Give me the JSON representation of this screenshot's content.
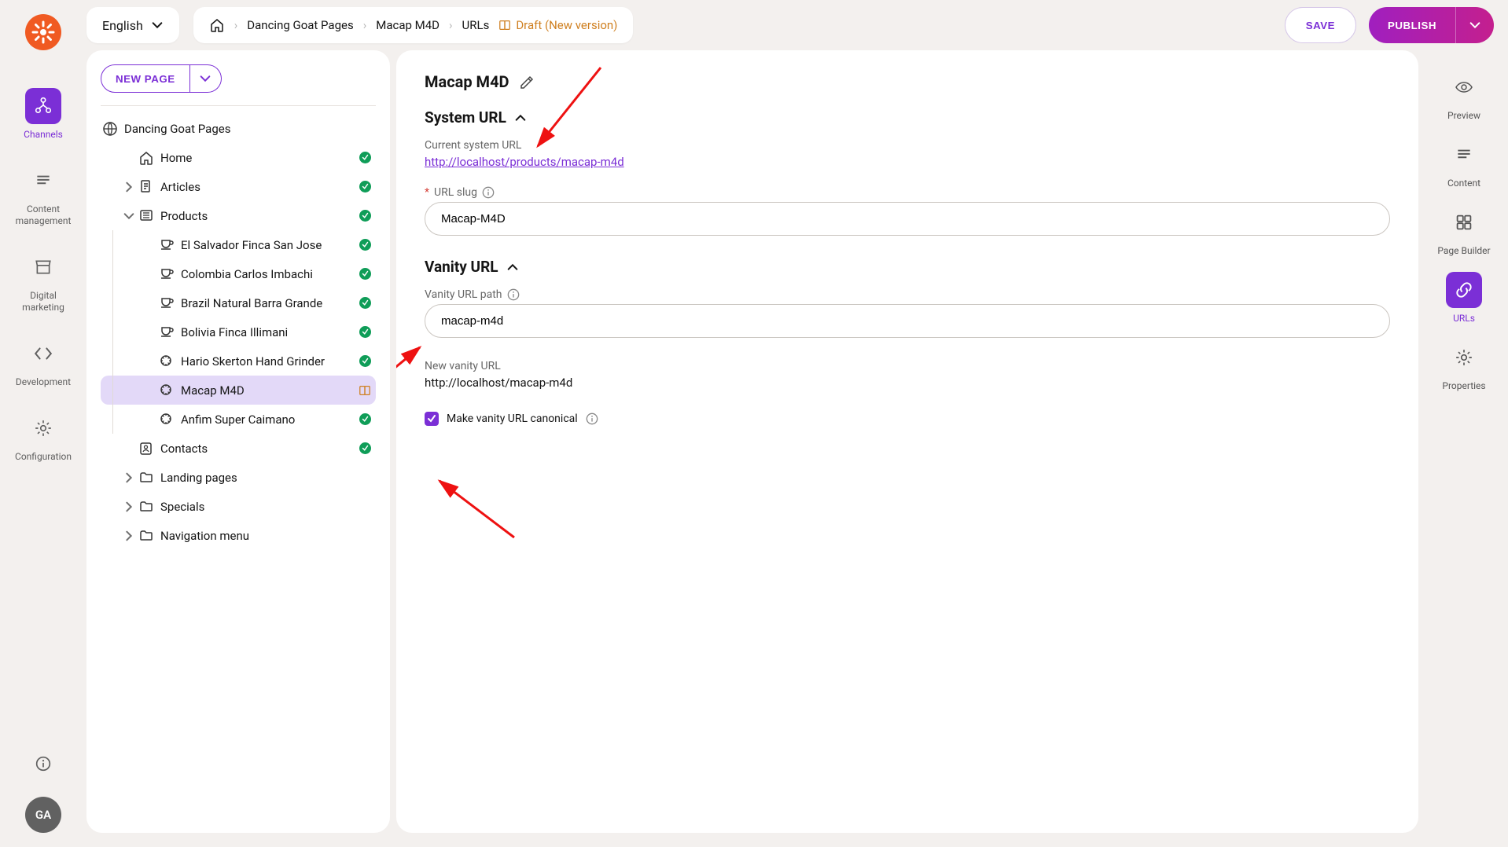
{
  "topbar": {
    "language": "English",
    "breadcrumbs": [
      "Dancing Goat Pages",
      "Macap M4D",
      "URLs"
    ],
    "status": "Draft (New version)",
    "save_label": "SAVE",
    "publish_label": "PUBLISH"
  },
  "left_rail": {
    "items": [
      {
        "key": "channels",
        "label": "Channels",
        "active": true
      },
      {
        "key": "content-management",
        "label": "Content\nmanagement"
      },
      {
        "key": "digital-marketing",
        "label": "Digital\nmarketing"
      },
      {
        "key": "development",
        "label": "Development"
      },
      {
        "key": "configuration",
        "label": "Configuration"
      }
    ],
    "avatar": "GA"
  },
  "tree": {
    "new_page_label": "NEW PAGE",
    "root_label": "Dancing Goat Pages",
    "nodes": [
      {
        "label": "Home",
        "indent": 1,
        "icon": "home",
        "status": "published"
      },
      {
        "label": "Articles",
        "indent": 1,
        "icon": "doc",
        "status": "published",
        "expandable": true
      },
      {
        "label": "Products",
        "indent": 1,
        "icon": "folder",
        "status": "published",
        "expandable": true,
        "expanded": true
      },
      {
        "label": "El Salvador Finca San Jose",
        "indent": 2,
        "icon": "cup",
        "status": "published"
      },
      {
        "label": "Colombia Carlos Imbachi",
        "indent": 2,
        "icon": "cup",
        "status": "published"
      },
      {
        "label": "Brazil Natural Barra Grande",
        "indent": 2,
        "icon": "cup",
        "status": "published"
      },
      {
        "label": "Bolivia Finca Illimani",
        "indent": 2,
        "icon": "cup",
        "status": "published"
      },
      {
        "label": "Hario Skerton Hand Grinder",
        "indent": 2,
        "icon": "grinder",
        "status": "published"
      },
      {
        "label": "Macap M4D",
        "indent": 2,
        "icon": "grinder",
        "status": "draft",
        "selected": true
      },
      {
        "label": "Anfim Super Caimano",
        "indent": 2,
        "icon": "grinder",
        "status": "published"
      },
      {
        "label": "Contacts",
        "indent": 1,
        "icon": "contacts",
        "status": "published"
      },
      {
        "label": "Landing pages",
        "indent": 1,
        "icon": "folder2",
        "expandable": true
      },
      {
        "label": "Specials",
        "indent": 1,
        "icon": "folder2",
        "expandable": true
      },
      {
        "label": "Navigation menu",
        "indent": 1,
        "icon": "folder2",
        "expandable": true
      }
    ]
  },
  "form": {
    "page_title": "Macap M4D",
    "sections": {
      "system_url": {
        "title": "System URL",
        "current_label": "Current system URL",
        "current_value": "http://localhost/products/macap-m4d",
        "slug_label": "URL slug",
        "slug_value": "Macap-M4D"
      },
      "vanity_url": {
        "title": "Vanity URL",
        "path_label": "Vanity URL path",
        "path_value": "macap-m4d",
        "new_label": "New vanity URL",
        "new_value": "http://localhost/macap-m4d",
        "canonical_label": "Make vanity URL canonical",
        "canonical_checked": true
      }
    }
  },
  "right_rail": {
    "items": [
      {
        "key": "preview",
        "label": "Preview"
      },
      {
        "key": "content",
        "label": "Content"
      },
      {
        "key": "page-builder",
        "label": "Page Builder"
      },
      {
        "key": "urls",
        "label": "URLs",
        "active": true
      },
      {
        "key": "properties",
        "label": "Properties"
      }
    ]
  },
  "colors": {
    "primary": "#7b2fd6",
    "brand": "#f05a22",
    "draft": "#cf7f1f",
    "success": "#0f9d58"
  }
}
